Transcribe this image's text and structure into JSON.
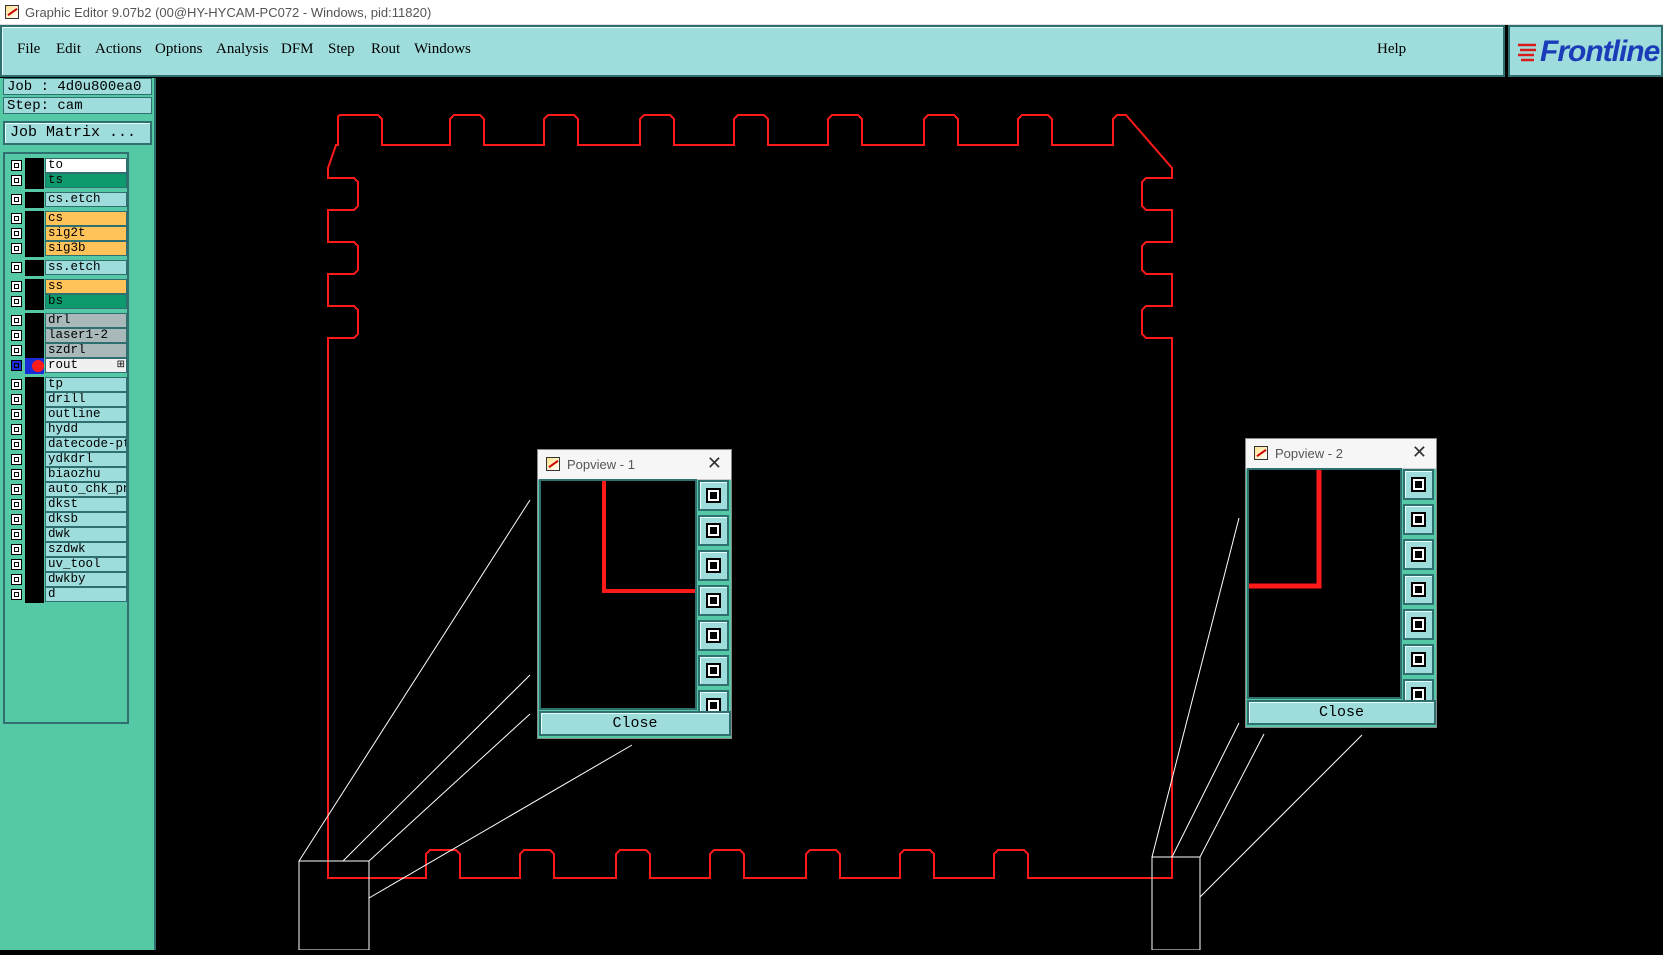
{
  "window": {
    "title": "Graphic Editor 9.07b2 (00@HY-HYCAM-PC072 - Windows, pid:11820)"
  },
  "menu": {
    "items": [
      {
        "label": "File",
        "key": "F"
      },
      {
        "label": "Edit",
        "key": "E"
      },
      {
        "label": "Actions",
        "key": "A"
      },
      {
        "label": "Options",
        "key": "O"
      },
      {
        "label": "Analysis",
        "key": "A"
      },
      {
        "label": "DFM",
        "key": "D"
      },
      {
        "label": "Step",
        "key": "S"
      },
      {
        "label": "Rout",
        "key": "R"
      },
      {
        "label": "Windows",
        "key": "W"
      }
    ],
    "help": "Help"
  },
  "logo": {
    "text": "Frontline"
  },
  "job": {
    "job_text": "Job : 4d0u800ea0",
    "step_text": "Step: cam",
    "matrix_label": "Job Matrix ..."
  },
  "layers": [
    {
      "name": "to",
      "color": "#ffffff"
    },
    {
      "name": "ts",
      "color": "#0f9a6e"
    },
    {
      "name": "cs.etch",
      "color": "#9fdcdc"
    },
    {
      "name": "cs",
      "color": "#ffc35a"
    },
    {
      "name": "sig2t",
      "color": "#ffc35a"
    },
    {
      "name": "sig3b",
      "color": "#ffc35a"
    },
    {
      "name": "ss.etch",
      "color": "#9fdcdc"
    },
    {
      "name": "ss",
      "color": "#ffc35a"
    },
    {
      "name": "bs",
      "color": "#0f9a6e"
    },
    {
      "name": "drl",
      "color": "#a9b8b8"
    },
    {
      "name": "laser1-2",
      "color": "#a9b8b8"
    },
    {
      "name": "szdrl",
      "color": "#a9b8b8"
    },
    {
      "name": "rout",
      "color": "#f0f0f0",
      "active": true
    },
    {
      "name": "tp",
      "color": "#9fdcdc"
    },
    {
      "name": "drill",
      "color": "#9fdcdc"
    },
    {
      "name": "outline",
      "color": "#9fdcdc"
    },
    {
      "name": "hydd",
      "color": "#9fdcdc"
    },
    {
      "name": "datecode-ptc",
      "color": "#9fdcdc"
    },
    {
      "name": "ydkdrl",
      "color": "#9fdcdc"
    },
    {
      "name": "biaozhu",
      "color": "#9fdcdc"
    },
    {
      "name": "auto_chk_pni",
      "color": "#9fdcdc"
    },
    {
      "name": "dkst",
      "color": "#9fdcdc"
    },
    {
      "name": "dksb",
      "color": "#9fdcdc"
    },
    {
      "name": "dwk",
      "color": "#9fdcdc"
    },
    {
      "name": "szdwk",
      "color": "#9fdcdc"
    },
    {
      "name": "uv_tool",
      "color": "#9fdcdc"
    },
    {
      "name": "dwkby",
      "color": "#9fdcdc"
    },
    {
      "name": "d",
      "color": "#9fdcdc"
    }
  ],
  "popviews": [
    {
      "title": "Popview - 1",
      "close_label": "Close"
    },
    {
      "title": "Popview - 2",
      "close_label": "Close"
    }
  ],
  "colors": {
    "rout_outline": "#ff1a1a",
    "accent": "#9fdcdc",
    "panel": "#55c9a6"
  }
}
